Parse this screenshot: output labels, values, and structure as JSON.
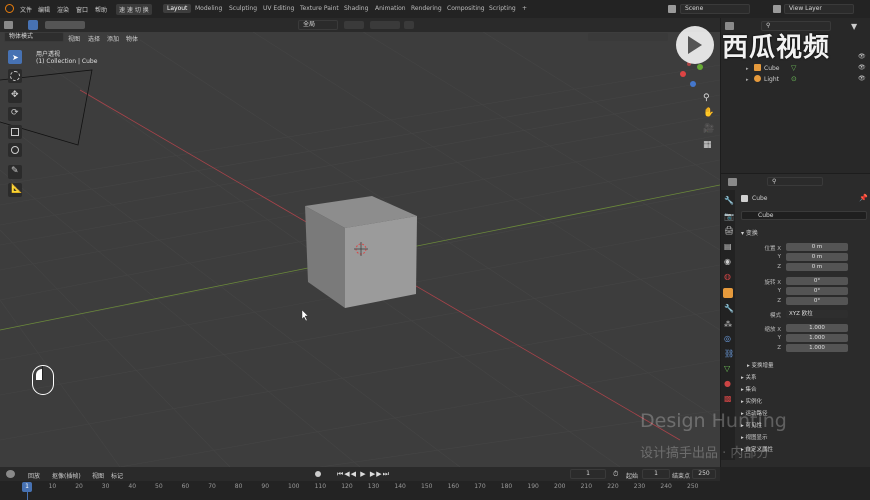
{
  "topbar": {
    "menus": [
      "文件",
      "编辑",
      "渲染",
      "窗口",
      "帮助"
    ],
    "status": "速 速 切 换",
    "workspaces": [
      "Layout",
      "Modeling",
      "Sculpting",
      "UV Editing",
      "Texture Paint",
      "Shading",
      "Animation",
      "Rendering",
      "Compositing",
      "Scripting"
    ],
    "active_workspace": "Layout",
    "scene": "Scene",
    "view_layer": "View Layer"
  },
  "viewport_header": {
    "mode": "物体模式",
    "menus": [
      "视图",
      "选择",
      "添加",
      "物体"
    ],
    "transform_space": "全局"
  },
  "viewport": {
    "view_name": "用户透视",
    "collection_info": "(1) Collection | Cube"
  },
  "outliner": {
    "items": [
      {
        "name": "Cube"
      },
      {
        "name": "Light"
      }
    ]
  },
  "properties": {
    "object_name": "Cube",
    "data_name": "Cube",
    "transform_title": "变换",
    "location_label": "位置 X",
    "location": [
      "0 m",
      "0 m",
      "0 m"
    ],
    "rotation_label": "旋转 X",
    "rotation": [
      "0°",
      "0°",
      "0°"
    ],
    "mode_label": "模式",
    "rotation_mode": "XYZ 欧拉",
    "scale_label": "缩放 X",
    "scale": [
      "1.000",
      "1.000",
      "1.000"
    ],
    "axis_y": "Y",
    "axis_z": "Z",
    "delta_transform": "变换增量",
    "sections": [
      "关系",
      "集合",
      "实例化",
      "运动路径",
      "可见性",
      "视图显示",
      "自定义属性"
    ]
  },
  "timeline": {
    "menus": [
      "回放",
      "抠像(插帧)",
      "视图",
      "标记"
    ],
    "current_frame": "1",
    "start_label": "起始",
    "start": "1",
    "end_label": "结束点",
    "end": "250",
    "ticks": [
      "0",
      "10",
      "20",
      "30",
      "40",
      "50",
      "60",
      "70",
      "80",
      "90",
      "100",
      "110",
      "120",
      "130",
      "140",
      "150",
      "160",
      "170",
      "180",
      "190",
      "200",
      "210",
      "220",
      "230",
      "240",
      "250"
    ]
  },
  "watermark": {
    "brand": "西瓜视频",
    "line1": "Design Hunting",
    "line2": "设计搞手出品 · 内部分"
  }
}
